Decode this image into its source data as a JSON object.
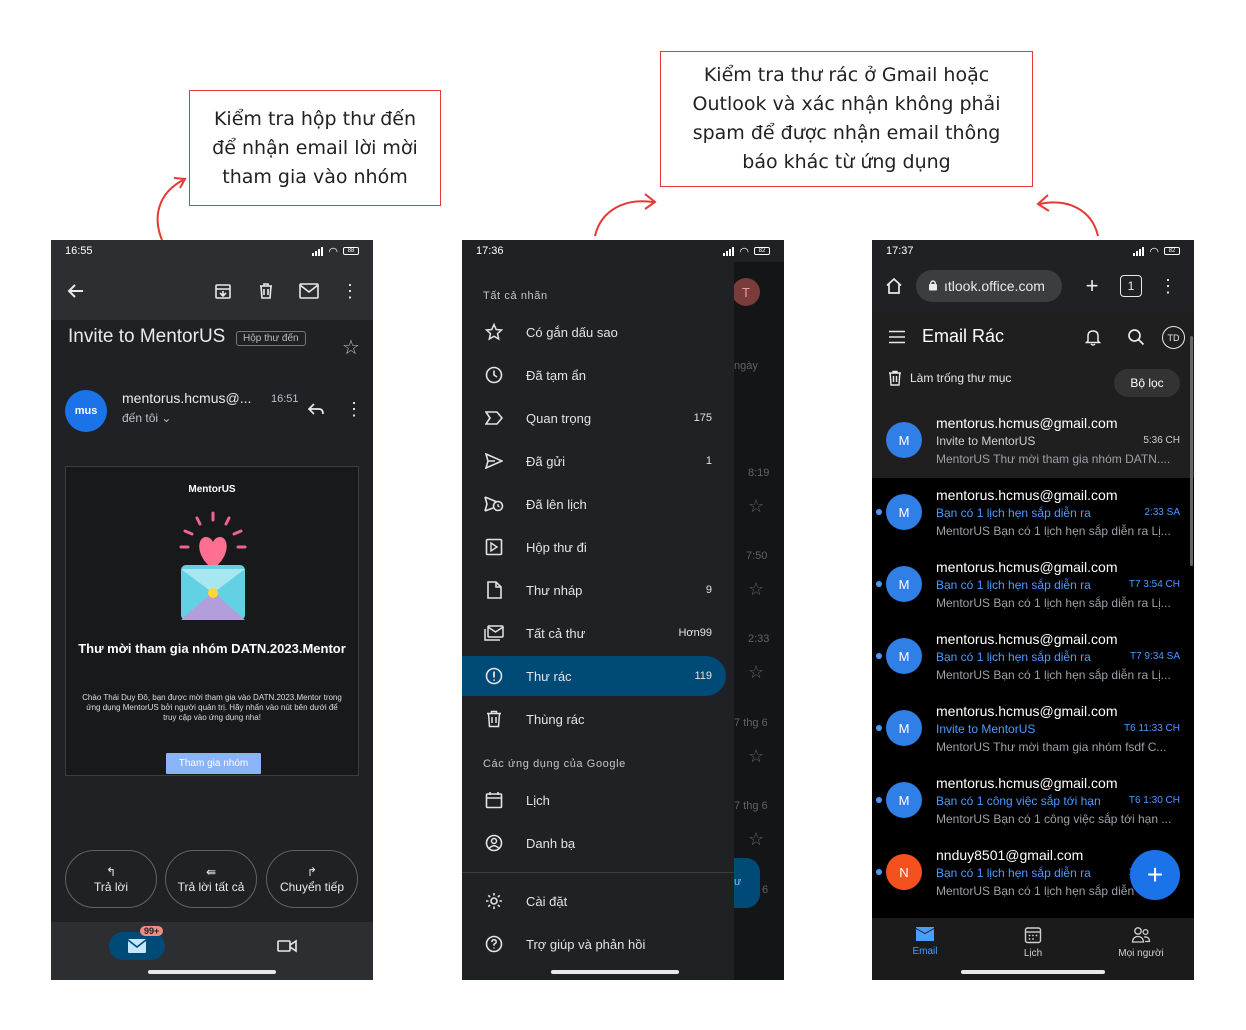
{
  "callouts": {
    "left": "Kiểm tra hộp thư đến để nhận email lời mời tham gia vào nhóm",
    "right": "Kiểm tra thư rác ở Gmail hoặc Outlook và xác nhận không phải spam để được nhận email thông báo khác từ ứng dụng"
  },
  "colors": {
    "callout_border": "#e53935",
    "gmail_active": "#004a77",
    "outlook_accent": "#4a9cff"
  },
  "gmail_email": {
    "status_time": "16:55",
    "battery": "88",
    "subject": "Invite to MentorUS",
    "label": "Hộp thư đến",
    "avatar_text": "mus",
    "sender": "mentorus.hcmus@...",
    "time": "16:51",
    "recipient": "đến tôi",
    "card": {
      "brand": "MentorUS",
      "title": "Thư mời tham gia nhóm DATN.2023.Mentor",
      "body": "Chào Thái Duy Đô, bạn được mời tham gia vào DATN.2023.Mentor trong ứng dụng MentorUS bởi người quản trị. Hãy nhấn vào nút bên dưới để truy cập vào ứng dụng nha!",
      "button": "Tham gia nhóm"
    },
    "actions": {
      "reply": "Trả lời",
      "reply_all": "Trả lời tất cả",
      "forward": "Chuyển tiếp"
    },
    "badge": "99+",
    "icons": [
      "back-icon",
      "archive-icon",
      "trash-icon",
      "mail-icon",
      "more-icon",
      "star-icon",
      "reply-icon",
      "mail-icon",
      "video-icon"
    ]
  },
  "gmail_drawer": {
    "status_time": "17:36",
    "battery": "82",
    "section_all": "Tất cả nhãn",
    "items": [
      {
        "label": "Có gắn dấu sao",
        "count": ""
      },
      {
        "label": "Đã tạm ẩn",
        "count": ""
      },
      {
        "label": "Quan trọng",
        "count": "175"
      },
      {
        "label": "Đã gửi",
        "count": "1"
      },
      {
        "label": "Đã lên lịch",
        "count": ""
      },
      {
        "label": "Hộp thư đi",
        "count": ""
      },
      {
        "label": "Thư nháp",
        "count": "9"
      },
      {
        "label": "Tất cả thư",
        "count": "Hơn99"
      },
      {
        "label": "Thư rác",
        "count": "119"
      },
      {
        "label": "Thùng rác",
        "count": ""
      }
    ],
    "section_google": "Các ứng dụng của Google",
    "google_items": [
      {
        "label": "Lịch"
      },
      {
        "label": "Danh bạ"
      }
    ],
    "bottom_items": [
      {
        "label": "Cài đặt"
      },
      {
        "label": "Trợ giúp và phản hồi"
      }
    ],
    "behind": {
      "avatar": "T",
      "word": "ngày",
      "times": [
        "8:19",
        "7:50",
        "2:33",
        "7 thg 6",
        "7 thg 6"
      ],
      "bottom_digit": "6",
      "bottom_text": "ư"
    }
  },
  "outlook": {
    "status_time": "17:37",
    "battery": "82",
    "url": "ıtlook.office.com",
    "tab_count": "1",
    "title": "Email Rác",
    "avatar": "TD",
    "empty_folder": "Làm trống thư mục",
    "filter": "Bộ lọc",
    "messages": [
      {
        "from": "mentorus.hcmus@gmail.com",
        "subject": "Invite to MentorUS",
        "time": "5:36 CH",
        "preview": "MentorUS Thư mời tham gia nhóm DATN....",
        "unread": false,
        "initial": "M"
      },
      {
        "from": "mentorus.hcmus@gmail.com",
        "subject": "Bạn có 1 lịch hẹn sắp diễn ra",
        "time": "2:33 SA",
        "preview": "MentorUS Bạn có 1 lịch hẹn sắp diễn ra Lị...",
        "unread": true,
        "initial": "M"
      },
      {
        "from": "mentorus.hcmus@gmail.com",
        "subject": "Bạn có 1 lịch hẹn sắp diễn ra",
        "time": "T7 3:54 CH",
        "preview": "MentorUS Bạn có 1 lịch hẹn sắp diễn ra Lị...",
        "unread": true,
        "initial": "M"
      },
      {
        "from": "mentorus.hcmus@gmail.com",
        "subject": "Bạn có 1 lịch hẹn sắp diễn ra",
        "time": "T7 9:34 SA",
        "preview": "MentorUS Bạn có 1 lịch hẹn sắp diễn ra Lị...",
        "unread": true,
        "initial": "M"
      },
      {
        "from": "mentorus.hcmus@gmail.com",
        "subject": "Invite to MentorUS",
        "time": "T6 11:33 CH",
        "preview": "MentorUS Thư mời tham gia nhóm fsdf C...",
        "unread": true,
        "initial": "M"
      },
      {
        "from": "mentorus.hcmus@gmail.com",
        "subject": "Bạn có 1 công việc sắp tới hạn",
        "time": "T6 1:30 CH",
        "preview": "MentorUS Bạn có 1 công việc sắp tới hạn ...",
        "unread": true,
        "initial": "M"
      },
      {
        "from": "nnduy8501@gmail.com",
        "subject": "Bạn có 1 lịch hẹn sắp diễn ra",
        "time": "1",
        "preview": "MentorUS Bạn có 1 lịch hẹn sắp diễn",
        "unread": true,
        "initial": "N"
      }
    ],
    "tabs": [
      "Email",
      "Lịch",
      "Mọi người"
    ]
  }
}
